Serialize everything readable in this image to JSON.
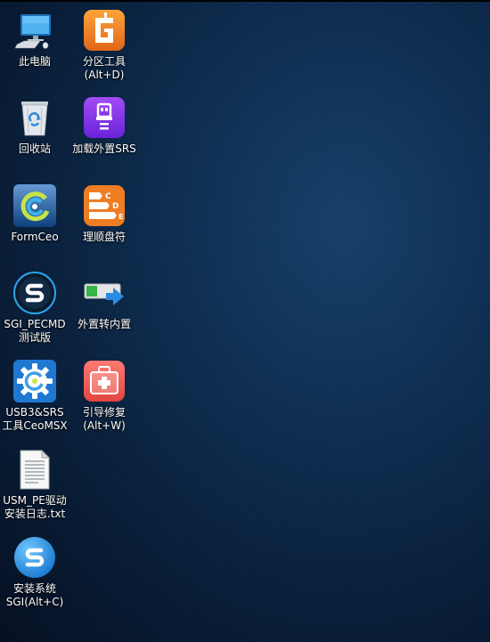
{
  "desktop": {
    "icons": [
      {
        "id": "this-pc",
        "line1": "此电脑",
        "line2": ""
      },
      {
        "id": "partition-tool",
        "line1": "分区工具",
        "line2": "(Alt+D)"
      },
      {
        "id": "recycle-bin",
        "line1": "回收站",
        "line2": ""
      },
      {
        "id": "load-external-srs",
        "line1": "加载外置SRS",
        "line2": ""
      },
      {
        "id": "formceo",
        "line1": "FormCeo",
        "line2": ""
      },
      {
        "id": "drive-letter-arrange",
        "line1": "理顺盘符",
        "line2": ""
      },
      {
        "id": "sgi-pecmd",
        "line1": "SGI_PECMD",
        "line2": "测试版"
      },
      {
        "id": "external-to-internal",
        "line1": "外置转内置",
        "line2": ""
      },
      {
        "id": "usb3-srs-tool",
        "line1": "USB3&SRS",
        "line2": "工具CeoMSX"
      },
      {
        "id": "boot-repair",
        "line1": "引导修复",
        "line2": "(Alt+W)"
      },
      {
        "id": "usm-pe-driver-log",
        "line1": "USM_PE驱动",
        "line2": "安装日志.txt"
      },
      {
        "id": "install-system-sgi",
        "line1": "安装系统",
        "line2": "SGI(Alt+C)"
      }
    ]
  },
  "colors": {
    "background": "#0d2c4f",
    "partition_orange": "#f08a24",
    "purple": "#7c3aed",
    "blue": "#1e88e5",
    "repair_red": "#ee5a55"
  }
}
